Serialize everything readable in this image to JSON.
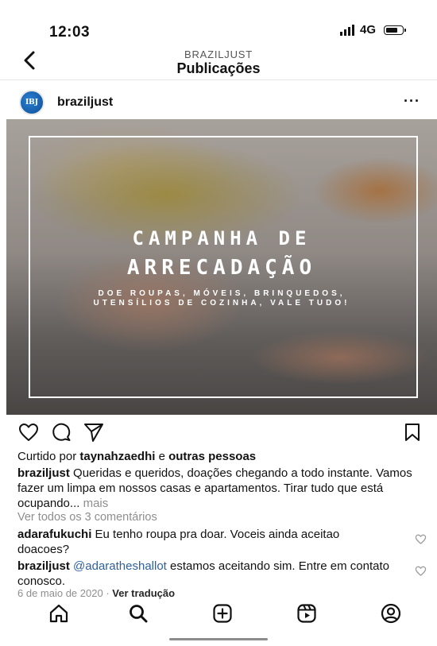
{
  "status_bar": {
    "time": "12:03",
    "network": "4G"
  },
  "header": {
    "account": "BRAZILJUST",
    "title": "Publicações"
  },
  "post": {
    "avatar_text": "IBJ",
    "username": "braziljust",
    "image": {
      "title_line1": "CAMPANHA DE",
      "title_line2": "ARRECADAÇÃO",
      "subtitle_line1": "DOE ROUPAS, MÓVEIS, BRINQUEDOS,",
      "subtitle_line2": "UTENSÍLIOS DE COZINHA, VALE TUDO!"
    },
    "likes": {
      "prefix": "Curtido por",
      "user": "taynahzaedhi",
      "joiner": "e",
      "others": "outras pessoas"
    },
    "caption": {
      "username": "braziljust",
      "text": "Queridas e queridos, doações chegando a todo instante. Vamos fazer um limpa em nossos casas e apartamentos. Tirar tudo que está ocupando...",
      "more": "mais"
    },
    "view_comments": "Ver todos os 3 comentários",
    "comments": [
      {
        "username": "adarafukuchi",
        "mention": "",
        "text": "Eu tenho roupa pra doar. Voceis ainda aceitao doacoes?"
      },
      {
        "username": "braziljust",
        "mention": "@adaratheshallot",
        "text": "estamos aceitando sim. Entre em contato conosco."
      }
    ],
    "date": "6 de maio de 2020",
    "separator": "·",
    "translate": "Ver tradução"
  },
  "icons": {
    "back": "chevron-left-icon",
    "more": "more-horizontal-icon",
    "like": "heart-icon",
    "comment": "comment-icon",
    "share": "send-icon",
    "save": "bookmark-icon",
    "nav": [
      "home-icon",
      "search-icon",
      "create-icon",
      "reels-icon",
      "profile-icon"
    ]
  }
}
